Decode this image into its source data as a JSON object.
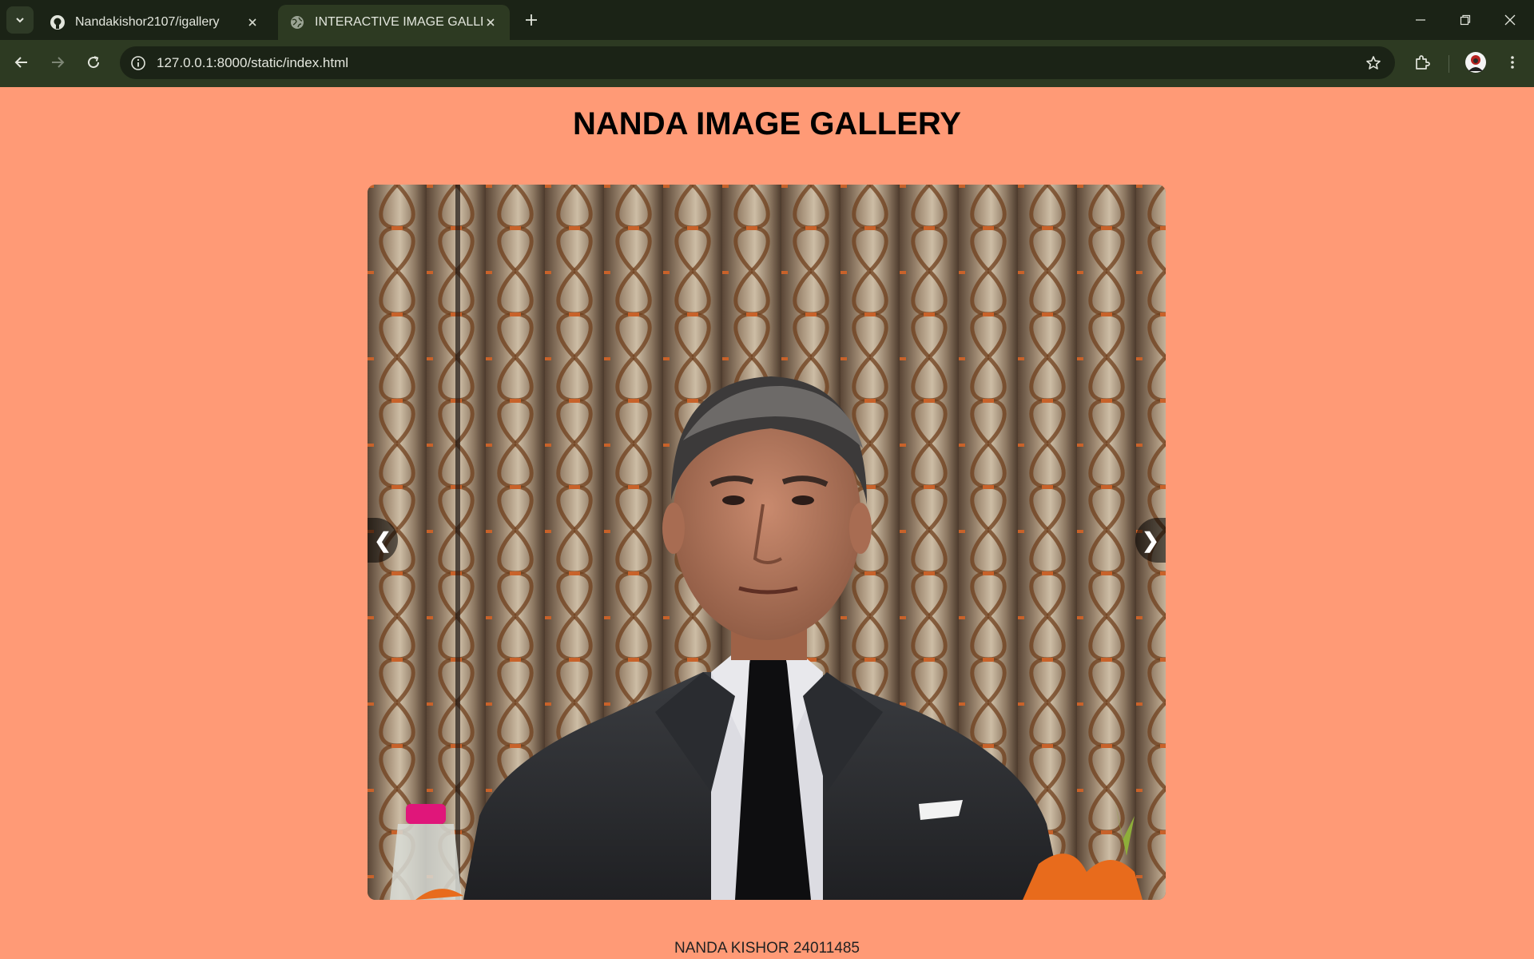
{
  "browser": {
    "tabs": [
      {
        "title": "Nandakishor2107/igallery",
        "icon": "github-icon",
        "active": false
      },
      {
        "title": "INTERACTIVE IMAGE GALLERY",
        "icon": "globe-icon",
        "active": true
      }
    ],
    "url": "127.0.0.1:8000/static/index.html"
  },
  "page": {
    "title": "NANDA IMAGE GALLERY",
    "footer": "NANDA KISHOR 24011485",
    "prev_label": "❮",
    "next_label": "❯",
    "background": "#FF9A76"
  },
  "gallery": {
    "current_image": "portrait photo of a man in a dark suit and black tie against patterned curtains"
  }
}
